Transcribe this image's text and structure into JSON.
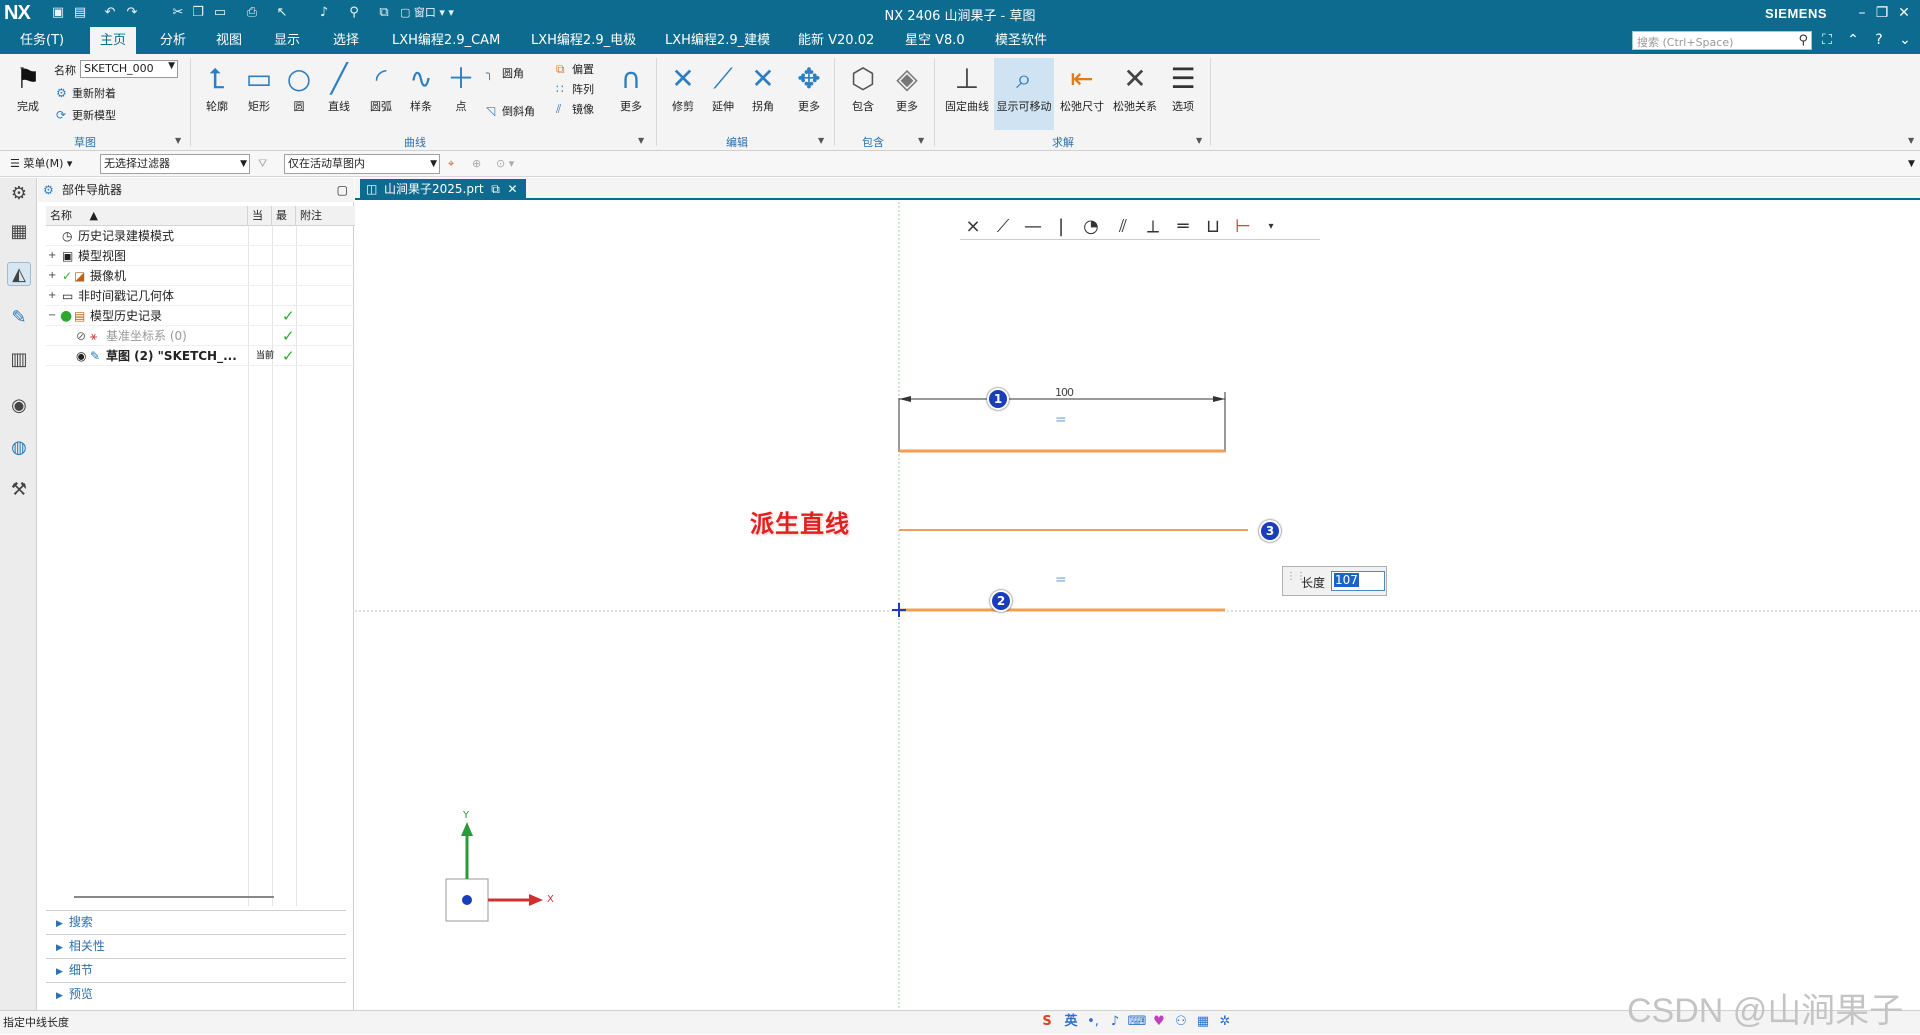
{
  "titlebar": {
    "logo": "NX",
    "window_title": "NX 2406  山涧果子 - 草图",
    "window_menu": "窗口",
    "brand": "SIEMENS"
  },
  "menu": {
    "tabs": [
      "任务(T)",
      "主页",
      "分析",
      "视图",
      "显示",
      "选择",
      "LXH编程2.9_CAM",
      "LXH编程2.9_电极",
      "LXH编程2.9_建模",
      "能新 V20.02",
      "星空 V8.0",
      "模圣软件"
    ],
    "active_tab": "主页",
    "search_placeholder": "搜索 (Ctrl+Space)"
  },
  "ribbon": {
    "finish_label": "完成",
    "name_label": "名称",
    "sketch_name": "SKETCH_000",
    "reattach_label": "重新附着",
    "update_model_label": "更新模型",
    "group_sketch": "草图",
    "curve_tools": {
      "profile": "轮廓",
      "rectangle": "矩形",
      "circle": "圆",
      "line": "直线",
      "arc": "圆弧",
      "spline": "样条",
      "point": "点",
      "fillet": "圆角",
      "chamfer": "倒斜角",
      "offset": "偏置",
      "pattern": "阵列",
      "mirror": "镜像",
      "more": "更多"
    },
    "group_curve": "曲线",
    "edit_tools": {
      "trim": "修剪",
      "extend": "延伸",
      "corner": "拐角",
      "more": "更多"
    },
    "group_edit": "编辑",
    "include_tools": {
      "include": "包含",
      "more": "更多"
    },
    "group_include": "包含",
    "solve_tools": {
      "fix_curve": "固定曲线",
      "show_movable": "显示可移动",
      "relax_dimension": "松弛尺寸",
      "relax_relation": "松弛关系",
      "options": "选项"
    },
    "group_solve": "求解"
  },
  "selbar": {
    "menu_label": "菜单(M)",
    "filter_value": "无选择过滤器",
    "scope_value": "仅在活动草图内"
  },
  "navigator": {
    "title": "部件导航器",
    "columns": [
      "名称",
      "当",
      "最",
      "附注"
    ],
    "rows": [
      {
        "label": "历史记录建模模式",
        "icon": "clock-icon",
        "expand": "",
        "check": false,
        "cur": ""
      },
      {
        "label": "模型视图",
        "icon": "view-icon",
        "expand": "+",
        "check": false,
        "cur": ""
      },
      {
        "label": "摄像机",
        "icon": "camera-icon",
        "expand": "+",
        "check": false,
        "cur": ""
      },
      {
        "label": "非时间戳记几何体",
        "icon": "folder-icon",
        "expand": "+",
        "check": false,
        "cur": ""
      },
      {
        "label": "模型历史记录",
        "icon": "history-icon",
        "expand": "−",
        "check": true,
        "cur": ""
      },
      {
        "label": "基准坐标系 (0)",
        "icon": "datum-csys-icon",
        "expand": "",
        "check": true,
        "cur": ""
      },
      {
        "label": "草图 (2) \"SKETCH_...",
        "icon": "sketch-icon",
        "expand": "",
        "check": true,
        "cur": "当前"
      }
    ],
    "sections": [
      "搜索",
      "相关性",
      "细节",
      "预览"
    ]
  },
  "document": {
    "tab_title": "山涧果子2025.prt"
  },
  "canvas": {
    "annotation": "派生直线",
    "dimension_value": "100",
    "length_label": "长度",
    "length_value": "107",
    "badges": [
      "1",
      "2",
      "3"
    ],
    "axis_x": "X",
    "axis_y": "Y",
    "equal_mark": "="
  },
  "status": {
    "prompt": "指定中线长度",
    "ime_mode": "英"
  },
  "watermark": "CSDN @山涧果子",
  "colors": {
    "title_blue": "#0d6b8f",
    "curve_orange": "#f0a050",
    "badge_blue": "#1a3dbb",
    "annotation_red": "#e32020",
    "check_green": "#2fa82f"
  }
}
